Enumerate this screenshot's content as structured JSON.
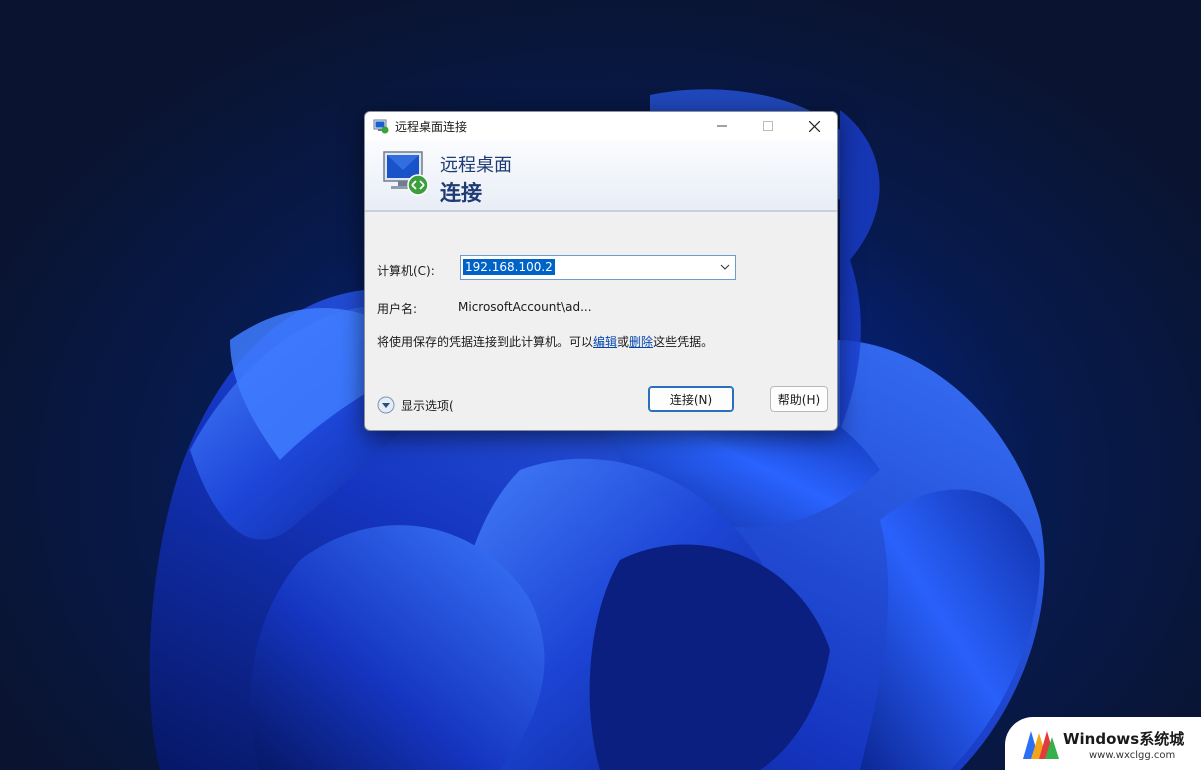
{
  "window": {
    "title": "远程桌面连接",
    "controls": {
      "minimize_icon": "minimize-icon",
      "maximize_icon": "maximize-icon",
      "close_icon": "close-icon"
    }
  },
  "banner": {
    "line1": "远程桌面",
    "line2": "连接",
    "icon": "remote-desktop-monitor-icon"
  },
  "form": {
    "computer_label": "计算机(C):",
    "computer_value": "192.168.100.2",
    "username_label": "用户名:",
    "username_value": "MicrosoftAccount\\ad...",
    "info_prefix": "将使用保存的凭据连接到此计算机。可以",
    "edit_link": "编辑",
    "or_text": "或",
    "delete_link": "删除",
    "info_suffix": "这些凭据。"
  },
  "footer": {
    "show_options": "显示选项(",
    "connect_button": "连接(N)",
    "help_button": "帮助(H)"
  },
  "watermark": {
    "title": "Windows系统城",
    "url": "www.wxclgg.com"
  },
  "colors": {
    "accent": "#0063c7",
    "banner_text": "#1f3b73",
    "dialog_bg": "#f0f0f0",
    "desktop_dark": "#071a4e",
    "bloom_blue": "#1f4fe0"
  }
}
